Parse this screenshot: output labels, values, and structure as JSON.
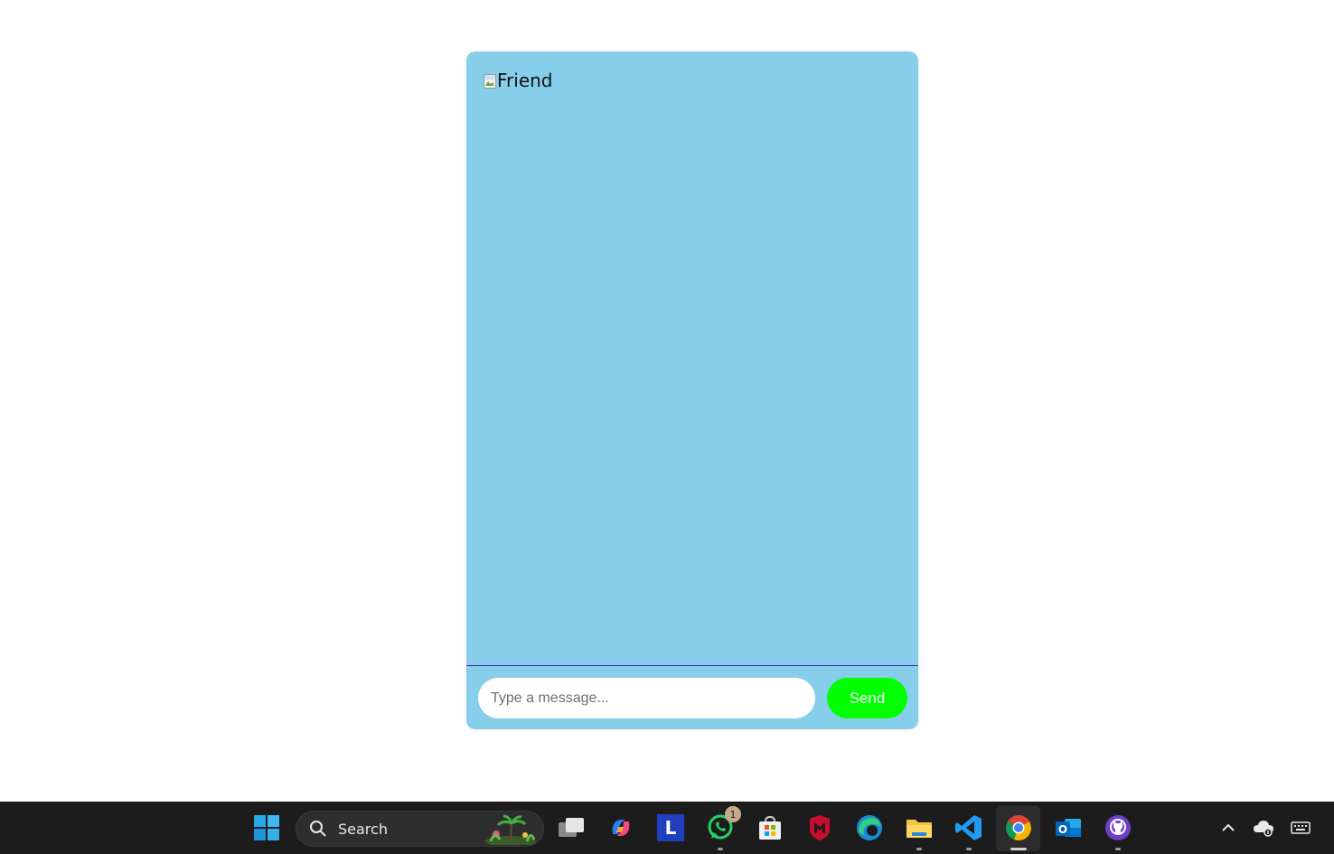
{
  "chat": {
    "friend_image_alt": "Friend",
    "input_placeholder": "Type a message...",
    "input_value": "",
    "send_label": "Send",
    "colors": {
      "card_background": "#87ceeb",
      "send_button": "#00ff00",
      "divider": "#4b2a9a"
    }
  },
  "taskbar": {
    "search_label": "Search",
    "apps": [
      {
        "name": "start",
        "icon": "windows-logo-icon"
      },
      {
        "name": "task-view",
        "icon": "task-view-icon"
      },
      {
        "name": "copilot",
        "icon": "copilot-icon"
      },
      {
        "name": "l-app",
        "icon": "l-app-icon",
        "label": "L"
      },
      {
        "name": "whatsapp",
        "icon": "whatsapp-icon",
        "badge": "1"
      },
      {
        "name": "microsoft-store",
        "icon": "store-icon"
      },
      {
        "name": "mcafee",
        "icon": "mcafee-icon"
      },
      {
        "name": "edge",
        "icon": "edge-icon"
      },
      {
        "name": "file-explorer",
        "icon": "folder-icon"
      },
      {
        "name": "vscode",
        "icon": "vscode-icon"
      },
      {
        "name": "chrome",
        "icon": "chrome-icon"
      },
      {
        "name": "outlook",
        "icon": "outlook-icon",
        "label": "O"
      },
      {
        "name": "github-desktop",
        "icon": "github-icon"
      }
    ],
    "tray": [
      {
        "name": "show-hidden",
        "icon": "chevron-up-icon"
      },
      {
        "name": "onedrive",
        "icon": "cloud-icon"
      },
      {
        "name": "keyboard",
        "icon": "keyboard-icon"
      }
    ]
  }
}
